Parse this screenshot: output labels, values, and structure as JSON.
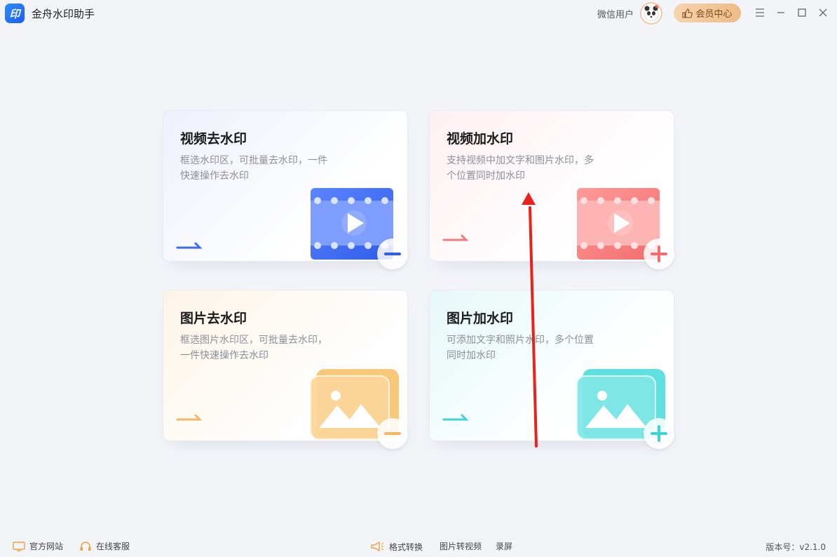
{
  "app": {
    "logo_text": "印",
    "title": "金舟水印助手"
  },
  "header": {
    "user_name": "微信用户",
    "vip_label": "会员中心"
  },
  "cards": [
    {
      "title": "视频去水印",
      "desc": "框选水印区，可批量去水印，一件快速操作去水印",
      "icon": "video-film-icon",
      "badge": "minus-icon",
      "accent": "#3b6bf0"
    },
    {
      "title": "视频加水印",
      "desc": "支持视频中加文字和图片水印，多个位置同时加水印",
      "icon": "video-film-icon",
      "badge": "plus-icon",
      "accent": "#f27b7b"
    },
    {
      "title": "图片去水印",
      "desc": "框选图片水印区，可批量去水印，一件快速操作去水印",
      "icon": "image-icon",
      "badge": "minus-icon",
      "accent": "#f2b864"
    },
    {
      "title": "图片加水印",
      "desc": "可添加文字和照片水印，多个位置同时加水印",
      "icon": "image-icon",
      "badge": "plus-icon",
      "accent": "#3fd3d6"
    }
  ],
  "footer": {
    "official_site": "官方网站",
    "online_service": "在线客服",
    "format_convert": "格式转换",
    "image_to_video": "图片转视频",
    "screen_record": "录屏",
    "version": "版本号：v2.1.0"
  }
}
